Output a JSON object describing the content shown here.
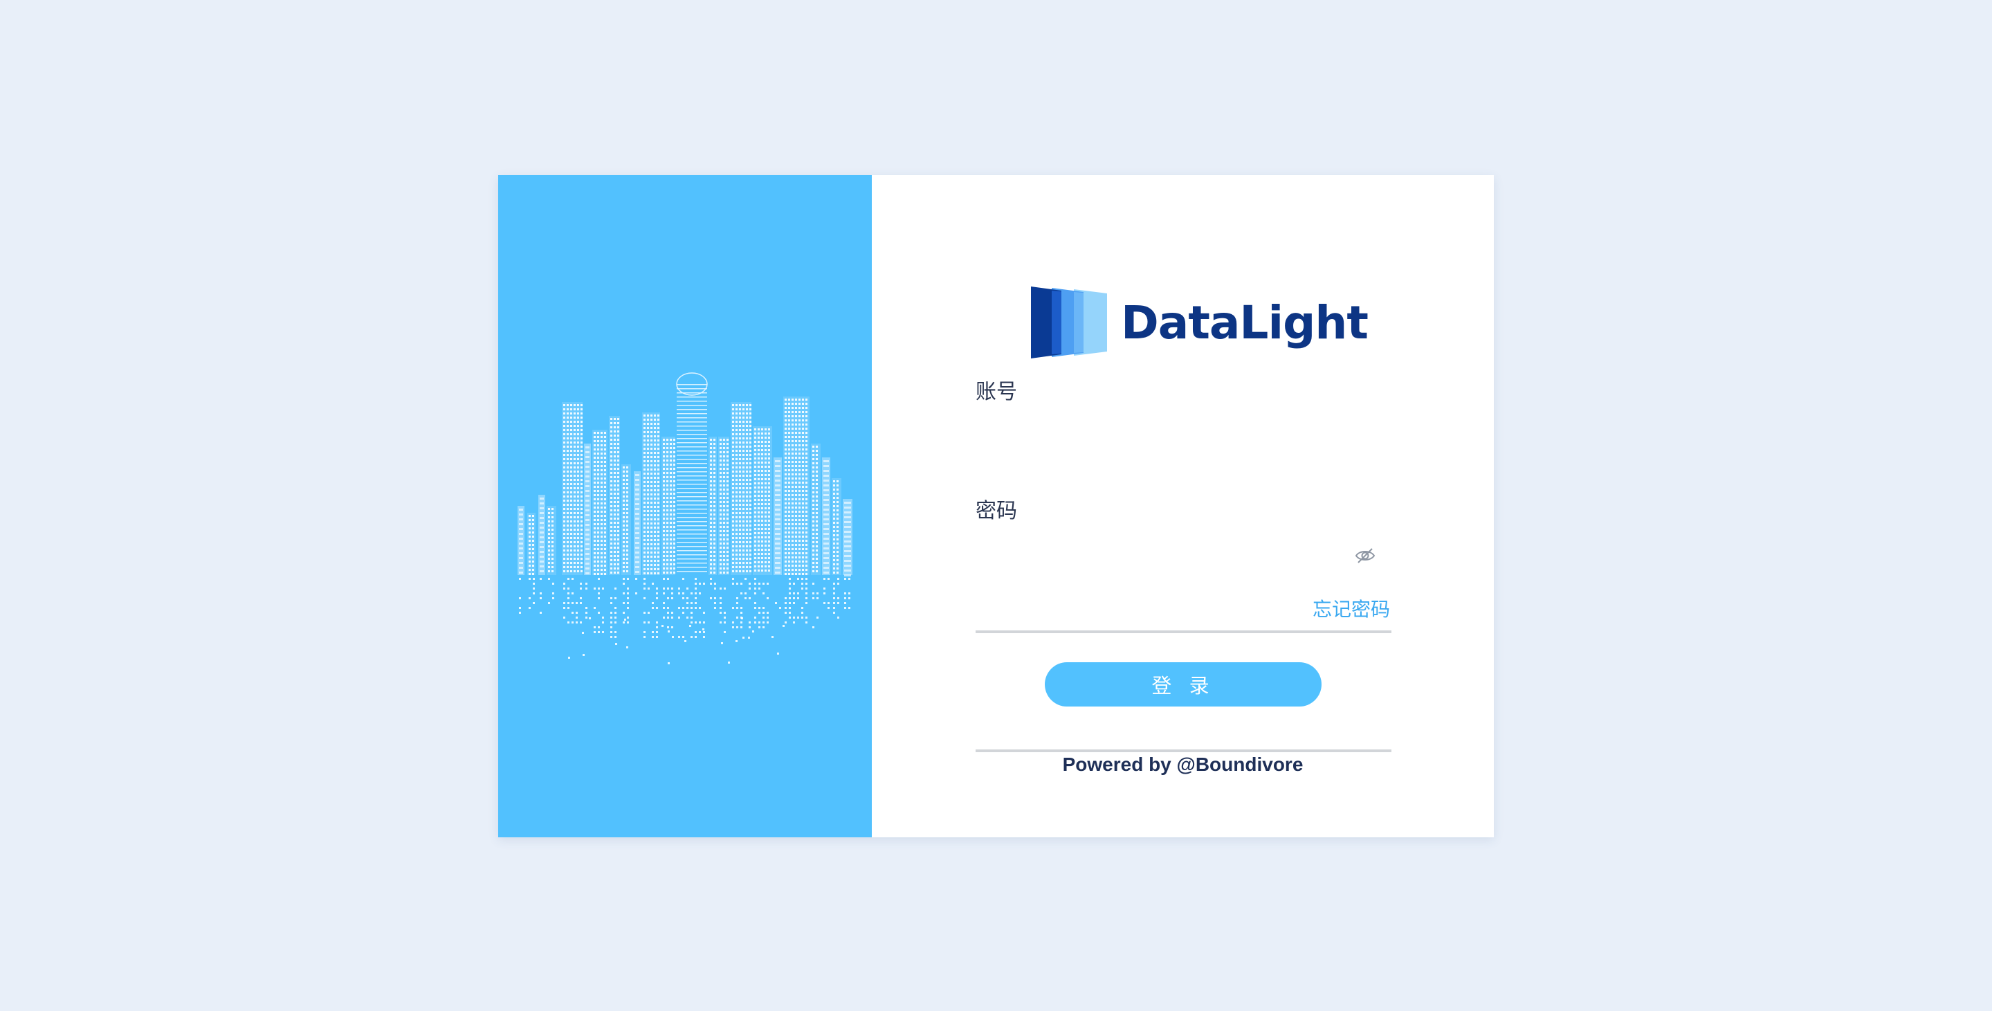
{
  "brand": {
    "name": "DataLight",
    "logo_icon": "layered-panels-logo",
    "primary_color": "#52c1fe",
    "text_color": "#0d3584"
  },
  "illustration": {
    "icon": "city-skyline-illustration",
    "panel_color": "#52c1fe"
  },
  "form": {
    "account_label": "账号",
    "account_value": "",
    "password_label": "密码",
    "password_value": "",
    "password_toggle_icon": "eye-slash-icon",
    "forgot_password": "忘记密码",
    "login_button": "登 录",
    "link_color": "#3aa8f0"
  },
  "footer": {
    "powered_by": "Powered by @Boundivore"
  }
}
